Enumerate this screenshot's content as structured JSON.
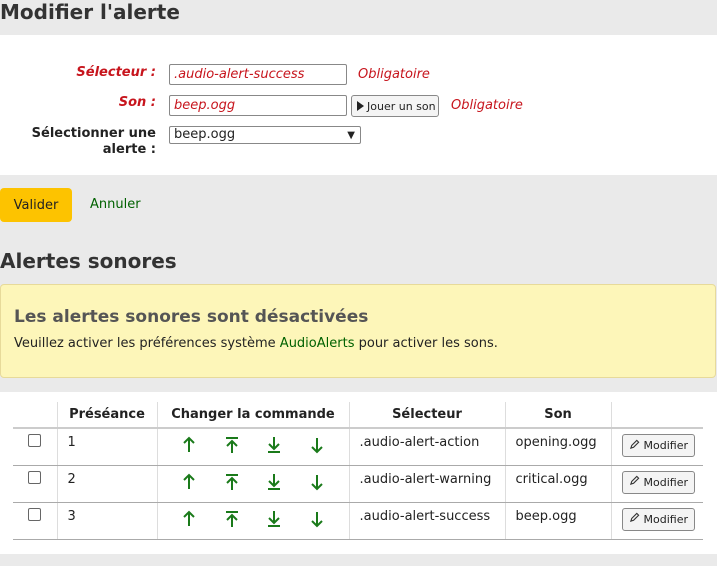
{
  "page_title": "Modifier l'alerte",
  "form": {
    "selector_label": "Sélecteur :",
    "selector_value": ".audio-alert-success",
    "selector_required": "Obligatoire",
    "sound_label": "Son :",
    "sound_value": "beep.ogg",
    "sound_required": "Obligatoire",
    "play_label": "Jouer un son",
    "select_label": "Sélectionner une alerte :",
    "select_value": "beep.ogg",
    "submit_label": "Valider",
    "cancel_label": "Annuler"
  },
  "section_title": "Alertes sonores",
  "alert": {
    "title": "Les alertes sonores sont désactivées",
    "text_before": "Veuillez activer les préférences système",
    "link": "AudioAlerts",
    "text_after": "pour activer les sons."
  },
  "table": {
    "headers": [
      "",
      "Préséance",
      "Changer la commande",
      "Sélecteur",
      "Son",
      ""
    ],
    "rows": [
      {
        "precedence": "1",
        "selector": ".audio-alert-action",
        "sound": "opening.ogg",
        "edit": "Modifier"
      },
      {
        "precedence": "2",
        "selector": ".audio-alert-warning",
        "sound": "critical.ogg",
        "edit": "Modifier"
      },
      {
        "precedence": "3",
        "selector": ".audio-alert-success",
        "sound": "beep.ogg",
        "edit": "Modifier"
      }
    ]
  },
  "colors": {
    "accent": "#fdc300",
    "link": "#006100",
    "required": "#c7151d",
    "arrow": "#1a7a1a"
  },
  "icons": [
    "play-icon",
    "arrow-up-icon",
    "arrow-top-icon",
    "arrow-bottom-icon",
    "arrow-down-icon",
    "pencil-icon"
  ]
}
